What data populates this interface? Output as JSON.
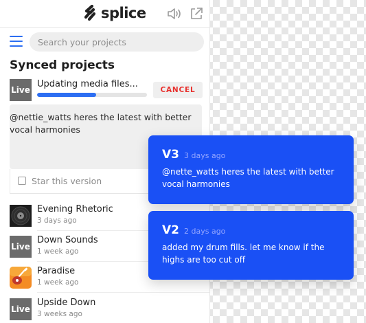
{
  "header": {
    "brand": "splice",
    "icons": [
      "splice-logo-icon",
      "speaker-icon",
      "external-link-icon"
    ]
  },
  "search": {
    "placeholder": "Search your projects"
  },
  "section_title": "Synced projects",
  "updating": {
    "thumb_label": "Live",
    "text": "Updating media files...",
    "progress": 0.54,
    "cancel_label": "CANCEL"
  },
  "message": {
    "text": "@nettie_watts heres the latest with better vocal harmonies"
  },
  "star": {
    "label": "Star this version",
    "checked": false
  },
  "projects": [
    {
      "name": "Evening Rhetoric",
      "date": "3 days ago",
      "thumb": "vinyl-record-icon"
    },
    {
      "name": "Down Sounds",
      "date": "1 week ago",
      "thumb": "live-icon",
      "thumb_label": "Live"
    },
    {
      "name": "Paradise",
      "date": "1 week ago",
      "thumb": "garageband-guitar-icon"
    },
    {
      "name": "Upside Down",
      "date": "3 weeks ago",
      "thumb": "live-icon",
      "thumb_label": "Live"
    }
  ],
  "versions": [
    {
      "version": "V3",
      "ago": "3 days ago",
      "text": "@nette_watts heres the latest with better vocal harmonies"
    },
    {
      "version": "V2",
      "ago": "2 days ago",
      "text": "added my drum fills. let me know if the highs are too cut off"
    }
  ],
  "colors": {
    "accent": "#2c6ef2",
    "card": "#1a50f5",
    "cancel": "#e8302d",
    "live_thumb": "#6b6b6b"
  }
}
